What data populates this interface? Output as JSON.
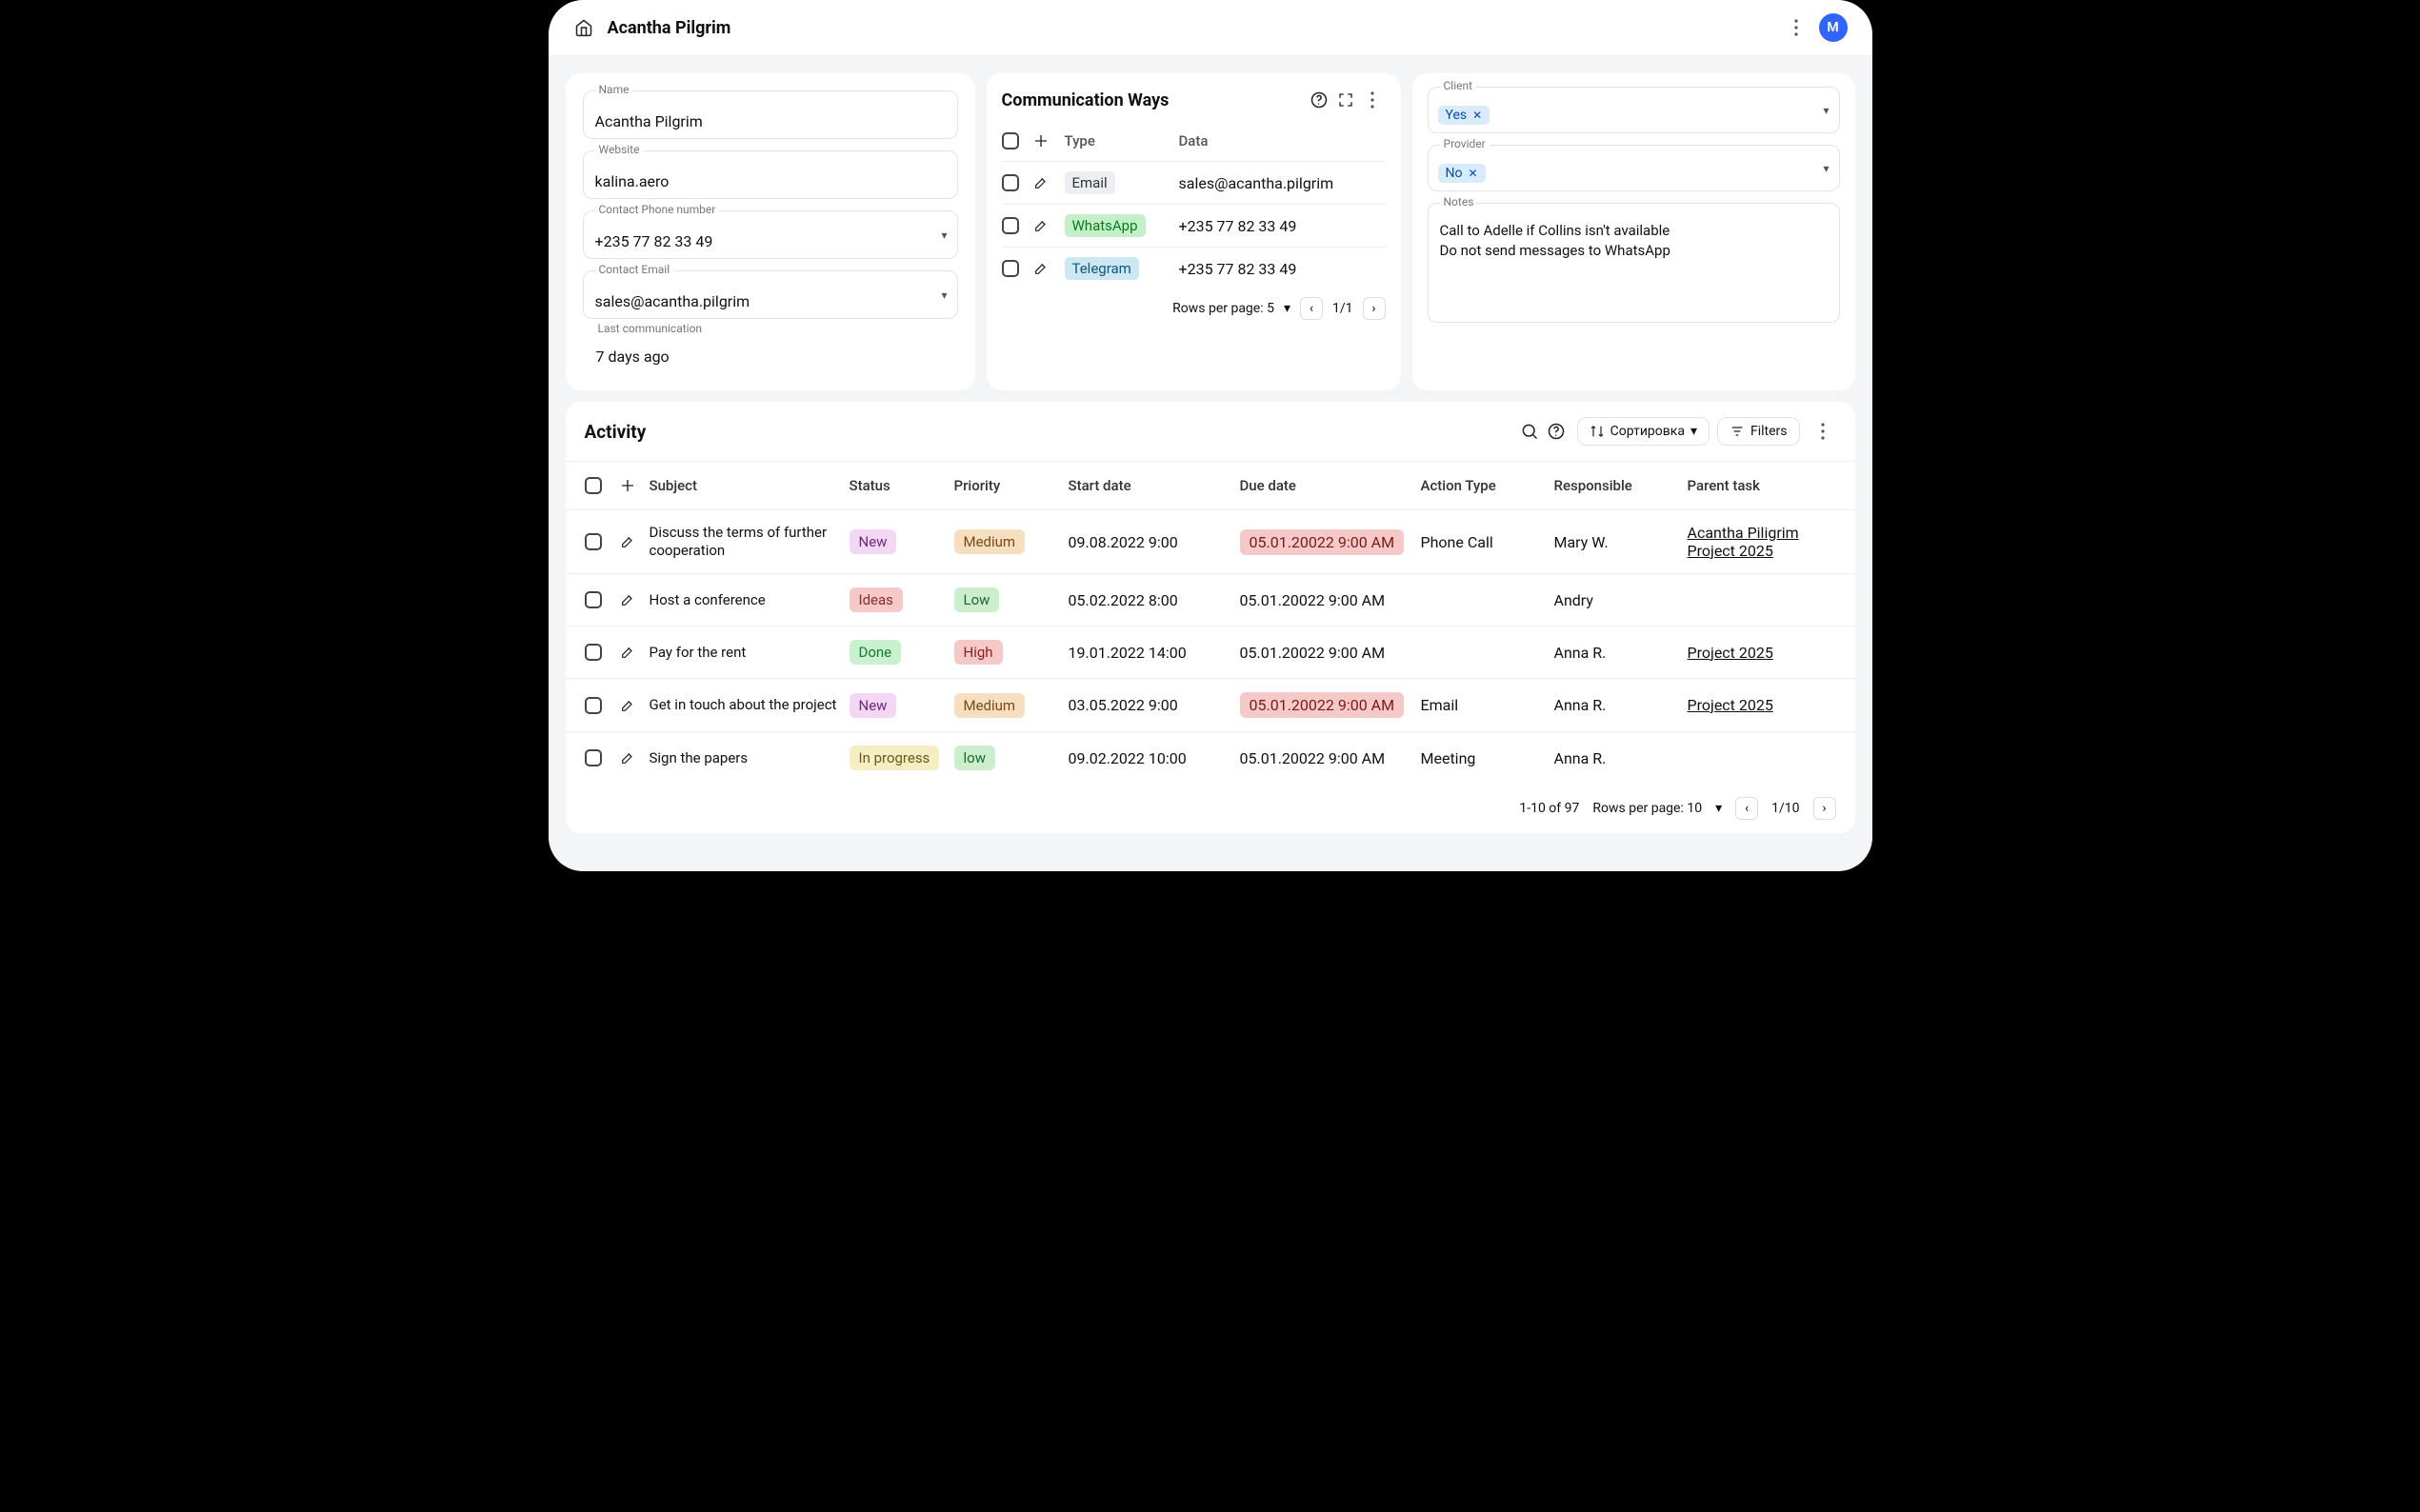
{
  "header": {
    "title": "Acantha Pilgrim",
    "avatar_initial": "M"
  },
  "details": {
    "name_label": "Name",
    "name": "Acantha Pilgrim",
    "website_label": "Website",
    "website": "kalina.aero",
    "phone_label": "Contact Phone number",
    "phone": "+235 77 82 33 49",
    "email_label": "Contact Email",
    "email": "sales@acantha.pilgrim",
    "lastcomm_label": "Last communication",
    "lastcomm": "7 days ago"
  },
  "comm": {
    "title": "Communication Ways",
    "cols": {
      "type": "Type",
      "data": "Data"
    },
    "rows": [
      {
        "type": "Email",
        "type_class": "email",
        "data": "sales@acantha.pilgrim"
      },
      {
        "type": "WhatsApp",
        "type_class": "whatsapp",
        "data": "+235 77 82 33 49"
      },
      {
        "type": "Telegram",
        "type_class": "telegram",
        "data": "+235 77 82 33 49"
      }
    ],
    "pager": {
      "rows_label": "Rows per page: 5",
      "pages": "1/1"
    }
  },
  "side": {
    "client_label": "Client",
    "client_value": "Yes",
    "provider_label": "Provider",
    "provider_value": "No",
    "notes_label": "Notes",
    "note1": "Call to Adelle if Collins isn't available",
    "note2": "Do not send messages to WhatsApp"
  },
  "activity": {
    "title": "Activity",
    "sort_label": "Сортировка",
    "filters_label": "Filters",
    "cols": {
      "subject": "Subject",
      "status": "Status",
      "priority": "Priority",
      "start": "Start date",
      "due": "Due date",
      "action": "Action Type",
      "responsible": "Responsible",
      "parent": "Parent task"
    },
    "rows": [
      {
        "subject": "Discuss the terms of further cooperation",
        "status": "New",
        "status_class": "st-new",
        "priority": "Medium",
        "priority_class": "pri-med",
        "start": "09.08.2022 9:00",
        "due": "05.01.20022 9:00 AM",
        "due_red": true,
        "action": "Phone Call",
        "responsible": "Mary W.",
        "parent": "Acantha Piligrim Project 2025"
      },
      {
        "subject": "Host a conference",
        "status": "Ideas",
        "status_class": "st-ideas",
        "priority": "Low",
        "priority_class": "pri-low",
        "start": "05.02.2022 8:00",
        "due": "05.01.20022 9:00 AM",
        "due_red": false,
        "action": "",
        "responsible": "Andry",
        "parent": ""
      },
      {
        "subject": "Pay for the rent",
        "status": "Done",
        "status_class": "st-done",
        "priority": "High",
        "priority_class": "pri-high",
        "start": "19.01.2022 14:00",
        "due": "05.01.20022 9:00 AM",
        "due_red": false,
        "action": "",
        "responsible": "Anna R.",
        "parent": "Project 2025"
      },
      {
        "subject": "Get in touch about the project",
        "status": "New",
        "status_class": "st-new",
        "priority": "Medium",
        "priority_class": "pri-med",
        "start": "03.05.2022 9:00",
        "due": "05.01.20022 9:00 AM",
        "due_red": true,
        "action": "Email",
        "responsible": "Anna R.",
        "parent": "Project 2025"
      },
      {
        "subject": "Sign the papers",
        "status": "In progress",
        "status_class": "st-inprog",
        "priority": "low",
        "priority_class": "pri-low",
        "start": "09.02.2022 10:00",
        "due": "05.01.20022 9:00 AM",
        "due_red": false,
        "action": "Meeting",
        "responsible": "Anna R.",
        "parent": ""
      }
    ],
    "footer": {
      "range": "1-10 of 97",
      "rows_label": "Rows per page: 10",
      "pages": "1/10"
    }
  }
}
